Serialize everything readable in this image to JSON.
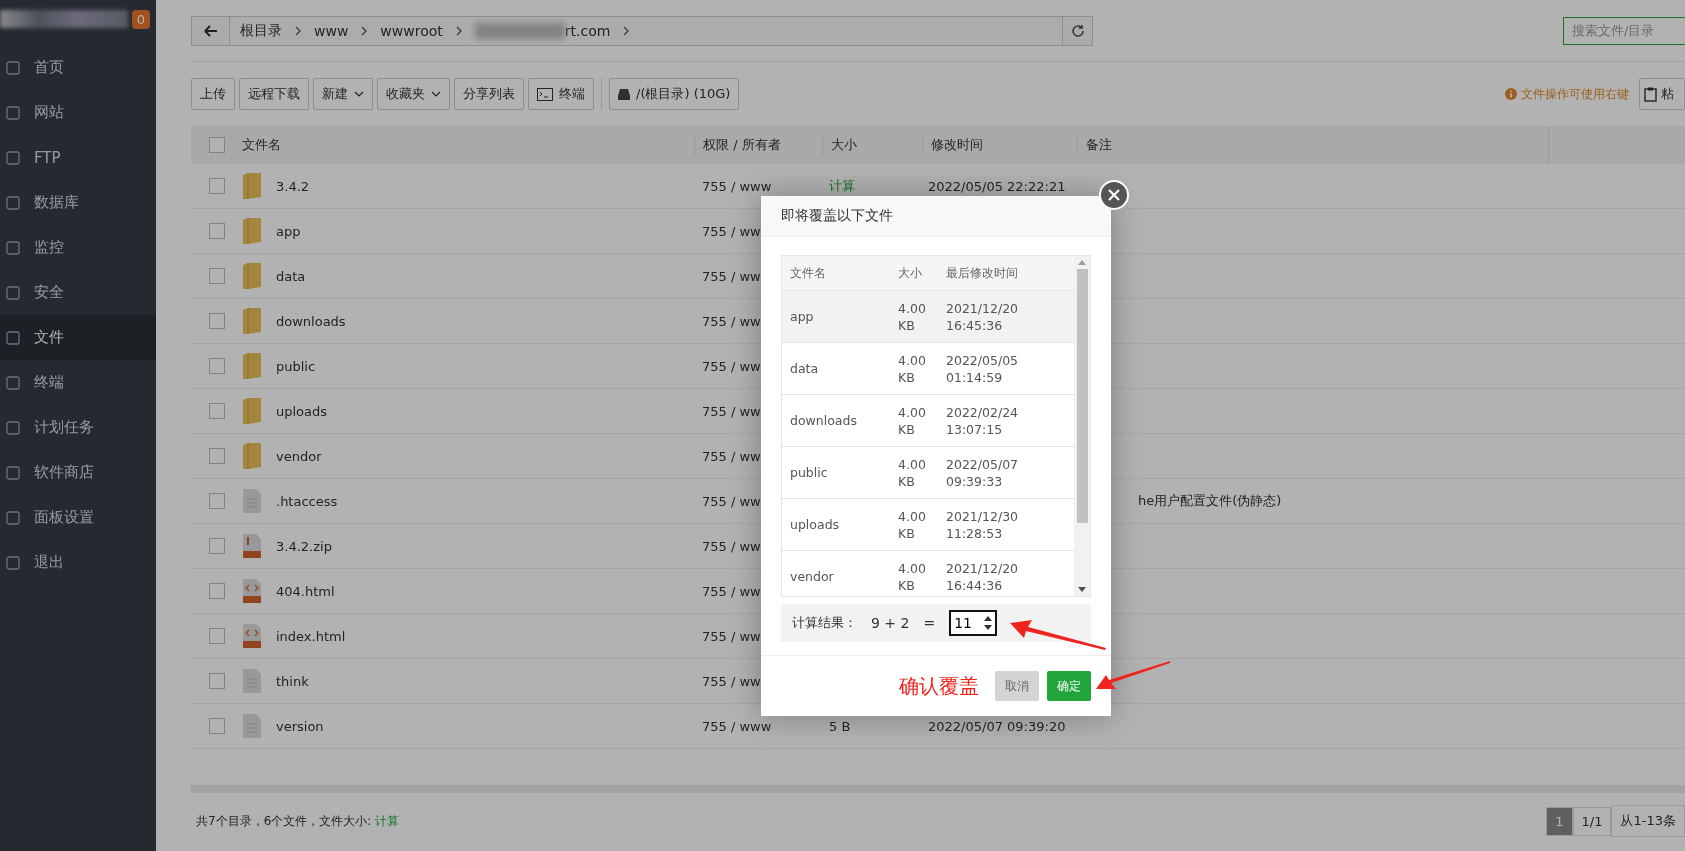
{
  "sidebar": {
    "badge": "0",
    "items": [
      {
        "label": "首页",
        "selected": false
      },
      {
        "label": "网站",
        "selected": false
      },
      {
        "label": "FTP",
        "selected": false
      },
      {
        "label": "数据库",
        "selected": false
      },
      {
        "label": "监控",
        "selected": false
      },
      {
        "label": "安全",
        "selected": false
      },
      {
        "label": "文件",
        "selected": true
      },
      {
        "label": "终端",
        "selected": false
      },
      {
        "label": "计划任务",
        "selected": false
      },
      {
        "label": "软件商店",
        "selected": false
      },
      {
        "label": "面板设置",
        "selected": false
      },
      {
        "label": "退出",
        "selected": false
      }
    ]
  },
  "breadcrumb": {
    "segments": [
      "根目录",
      "www",
      "wwwroot",
      "rt.com"
    ]
  },
  "search": {
    "placeholder": "搜索文件/目录"
  },
  "toolbar": {
    "buttons": [
      {
        "label": "上传",
        "kind": "plain"
      },
      {
        "label": "远程下载",
        "kind": "plain"
      },
      {
        "label": "新建",
        "kind": "dropdown"
      },
      {
        "label": "收藏夹",
        "kind": "dropdown"
      },
      {
        "label": "分享列表",
        "kind": "plain"
      },
      {
        "label": "终端",
        "kind": "terminal"
      },
      {
        "label": "/(根目录) (10G)",
        "kind": "disk"
      }
    ],
    "hint": "文件操作可使用右键",
    "paste_button": "粘"
  },
  "table": {
    "select_all_checked": false,
    "columns": [
      "文件名",
      "权限 / 所有者",
      "大小",
      "修改时间",
      "备注"
    ],
    "rows": [
      {
        "kind": "folder",
        "name": "3.4.2",
        "checked": false,
        "perms": "755 / www",
        "size": "计算",
        "mtime": "2022/05/05 22:22:21"
      },
      {
        "kind": "folder",
        "name": "app",
        "checked": false,
        "perms": "755 / ww"
      },
      {
        "kind": "folder",
        "name": "data",
        "checked": false,
        "perms": "755 / ww"
      },
      {
        "kind": "folder",
        "name": "downloads",
        "checked": false,
        "perms": "755 / ww"
      },
      {
        "kind": "folder",
        "name": "public",
        "checked": false,
        "perms": "755 / ww"
      },
      {
        "kind": "folder",
        "name": "uploads",
        "checked": false,
        "perms": "755 / ww"
      },
      {
        "kind": "folder",
        "name": "vendor",
        "checked": false,
        "perms": "755 / ww"
      },
      {
        "kind": "text",
        "name": ".htaccess",
        "checked": false,
        "perms": "755 / ww",
        "remark": "he用户配置文件(伪静态)"
      },
      {
        "kind": "zip",
        "name": "3.4.2.zip",
        "checked": false,
        "perms": "755 / ww"
      },
      {
        "kind": "html",
        "name": "404.html",
        "checked": false,
        "perms": "755 / ww"
      },
      {
        "kind": "html",
        "name": "index.html",
        "checked": false,
        "perms": "755 / ww"
      },
      {
        "kind": "text",
        "name": "think",
        "checked": false,
        "perms": "755 / ww"
      },
      {
        "kind": "text",
        "name": "version",
        "checked": false,
        "perms": "755 / www",
        "size": "5 B",
        "mtime": "2022/05/07 09:39:20"
      }
    ]
  },
  "footer": {
    "summary": "共7个目录，6个文件，文件大小: ",
    "calc_link": "计算",
    "pages": [
      {
        "label": "1",
        "selected": true
      }
    ],
    "page_count": "1/1",
    "range": "从1-13条"
  },
  "dialog": {
    "title": "即将覆盖以下文件",
    "columns": [
      "文件名",
      "大小",
      "最后修改时间"
    ],
    "rows": [
      {
        "name": "app",
        "size": [
          "4.00",
          "KB"
        ],
        "mtime": [
          "2021/12/20",
          "16:45:36"
        ],
        "hovered": true
      },
      {
        "name": "data",
        "size": [
          "4.00",
          "KB"
        ],
        "mtime": [
          "2022/05/05",
          "01:14:59"
        ],
        "hovered": false
      },
      {
        "name": "downloads",
        "size": [
          "4.00",
          "KB"
        ],
        "mtime": [
          "2022/02/24",
          "13:07:15"
        ],
        "hovered": false
      },
      {
        "name": "public",
        "size": [
          "4.00",
          "KB"
        ],
        "mtime": [
          "2022/05/07",
          "09:39:33"
        ],
        "hovered": false
      },
      {
        "name": "uploads",
        "size": [
          "4.00",
          "KB"
        ],
        "mtime": [
          "2021/12/30",
          "11:28:53"
        ],
        "hovered": false
      },
      {
        "name": "vendor",
        "size": [
          "4.00",
          "KB"
        ],
        "mtime": [
          "2021/12/20",
          "16:44:36"
        ],
        "hovered": false
      }
    ],
    "captcha": {
      "label": "计算结果：",
      "expression": "9 + 2",
      "equals": "=",
      "value": "11"
    },
    "annotation": "确认覆盖",
    "buttons": [
      {
        "label": "取消",
        "kind": "cancel",
        "disabled": true
      },
      {
        "label": "确定",
        "kind": "confirm",
        "disabled": false
      }
    ]
  }
}
